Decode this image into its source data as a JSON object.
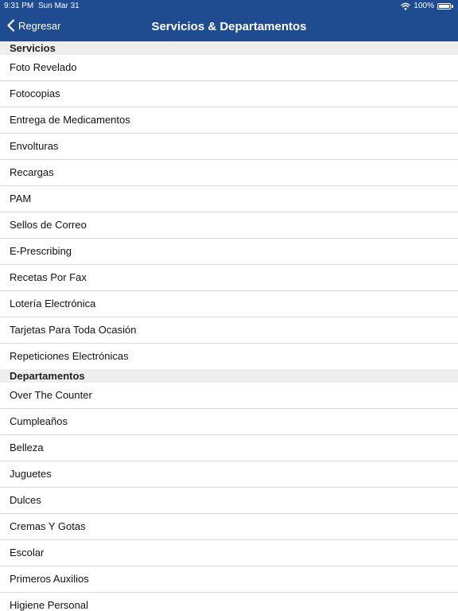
{
  "statusbar": {
    "time": "9:31 PM",
    "date": "Sun Mar 31",
    "battery": "100%",
    "battery_level": 1.0
  },
  "navbar": {
    "back_label": "Regresar",
    "title": "Servicios & Departamentos"
  },
  "sections": [
    {
      "header": "Servicios",
      "items": [
        "Foto Revelado",
        "Fotocopias",
        "Entrega de Medicamentos",
        "Envolturas",
        "Recargas",
        "PAM",
        "Sellos de Correo",
        "E-Prescribing",
        "Recetas Por Fax",
        "Lotería Electrónica",
        "Tarjetas Para Toda Ocasión",
        "Repeticiones Electrónicas"
      ]
    },
    {
      "header": "Departamentos",
      "items": [
        "Over The Counter",
        "Cumpleaños",
        "Belleza",
        "Juguetes",
        "Dulces",
        "Cremas Y Gotas",
        "Escolar",
        "Primeros Auxilios",
        "Higiene Personal"
      ]
    }
  ],
  "colors": {
    "nav_background": "#1f4b91",
    "section_background": "#eeeeee"
  },
  "icons": {
    "back": "chevron-left-icon",
    "wifi": "wifi-icon",
    "battery": "battery-icon"
  }
}
